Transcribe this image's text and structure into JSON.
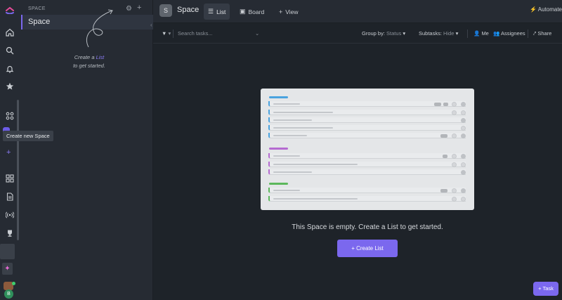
{
  "sidebar": {
    "section_label": "SPACE",
    "space_name": "Space",
    "hint_prefix": "Create a",
    "hint_link": "List",
    "hint_suffix": "to get started."
  },
  "rail": {
    "tooltip": "Create new Space",
    "avatar_initial": "B"
  },
  "header": {
    "space_badge": "S",
    "space_title": "Space",
    "tabs": [
      {
        "label": "List",
        "icon": "list-icon",
        "active": true
      },
      {
        "label": "Board",
        "icon": "board-icon",
        "active": false
      }
    ],
    "add_view": "View",
    "automate": "Automate"
  },
  "filterbar": {
    "search_placeholder": "Search tasks...",
    "group_by_label": "Group by:",
    "group_by_value": "Status",
    "subtasks_label": "Subtasks:",
    "subtasks_value": "Hide",
    "me": "Me",
    "assignees": "Assignees",
    "share": "Share"
  },
  "main": {
    "empty_message": "This Space is empty. Create a List to get started.",
    "create_list_button": "+ Create List",
    "task_button": "Task"
  },
  "colors": {
    "accent": "#7b68ee",
    "group_blue": "#4aa3df",
    "group_purple": "#b56bd1",
    "group_green": "#5cb85c"
  }
}
